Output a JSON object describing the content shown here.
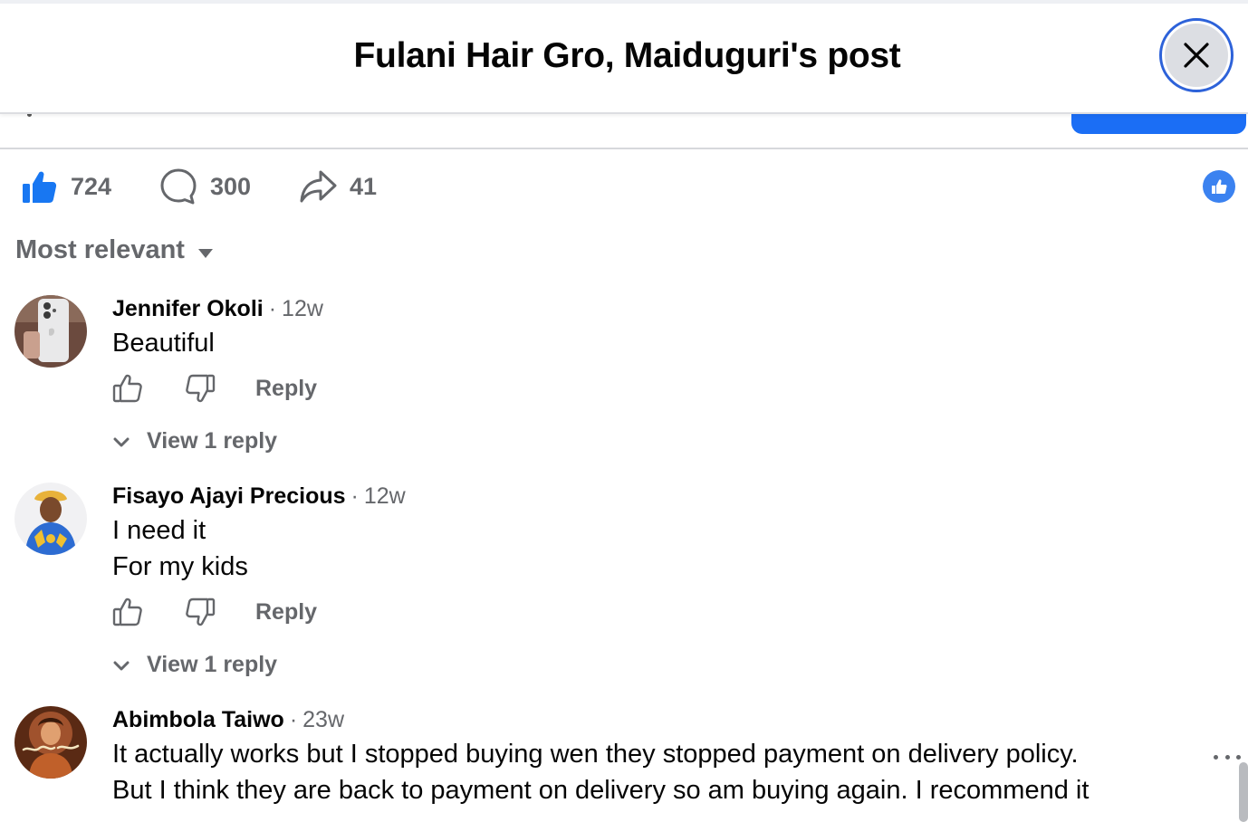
{
  "dialog": {
    "title": "Fulani Hair Gro, Maiduguri's post",
    "close_icon": "close-icon"
  },
  "stats": {
    "likes": "724",
    "comments": "300",
    "shares": "41"
  },
  "sort": {
    "label": "Most relevant"
  },
  "comments": [
    {
      "name": "Jennifer Okoli",
      "separator": "·",
      "time": "12w",
      "lines": [
        "Beautiful"
      ],
      "reply_label": "Reply",
      "view_replies": "View 1 reply"
    },
    {
      "name": "Fisayo Ajayi Precious",
      "separator": "·",
      "time": "12w",
      "lines": [
        "I need it",
        "For my kids"
      ],
      "reply_label": "Reply",
      "view_replies": "View 1 reply"
    },
    {
      "name": "Abimbola Taiwo",
      "separator": "·",
      "time": "23w",
      "lines": [
        "It actually works but I stopped buying wen they stopped payment on delivery policy.",
        "But I think they are back to payment on delivery so am buying again. I recommend it"
      ]
    }
  ],
  "colors": {
    "accent": "#1b6ef5",
    "secondary_text": "#65676b",
    "primary_text": "#050505"
  }
}
